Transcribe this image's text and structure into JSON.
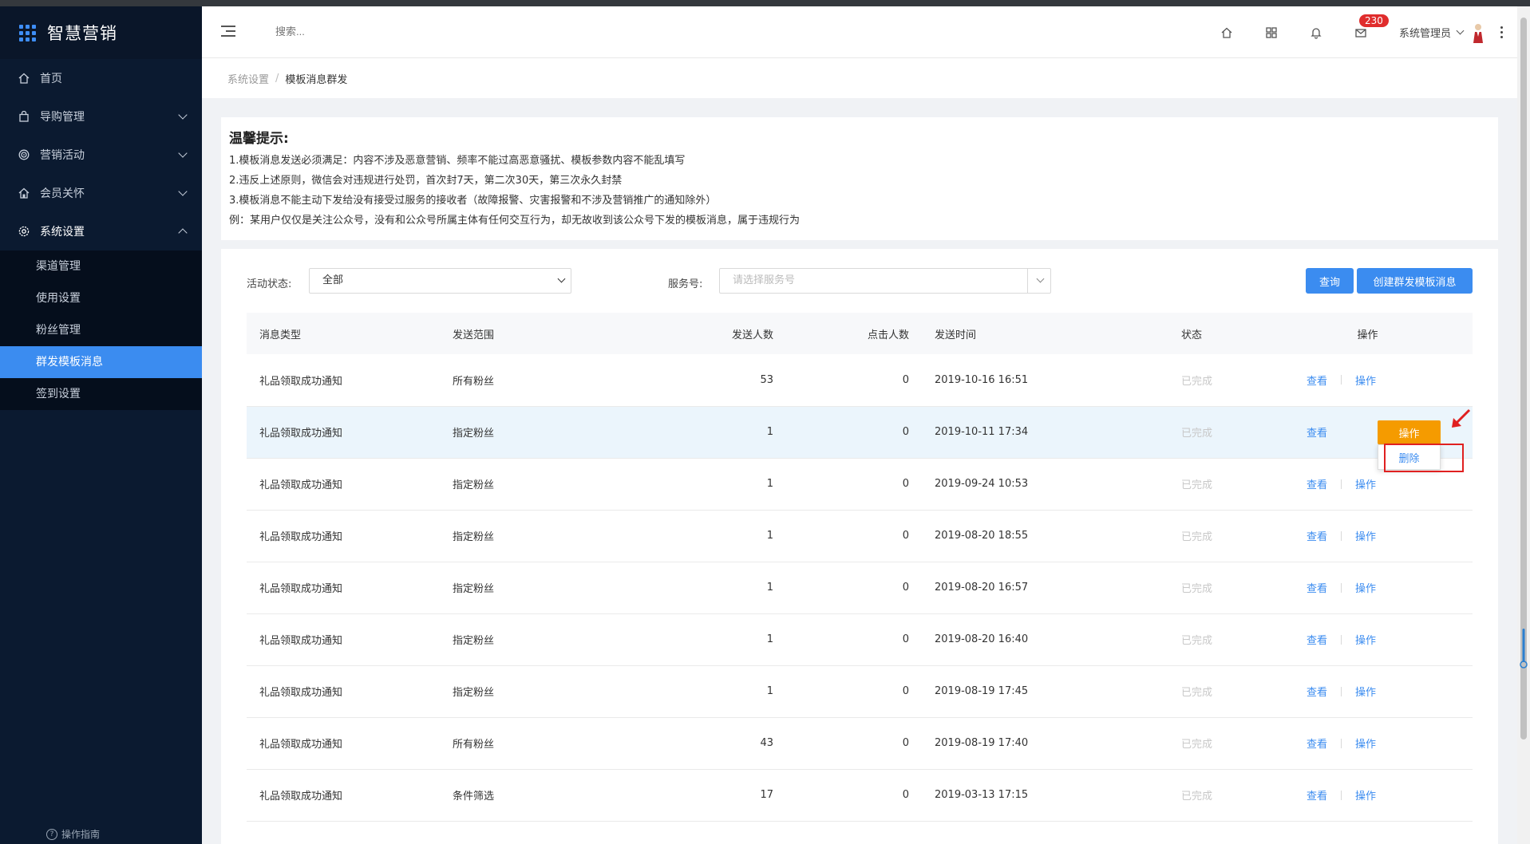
{
  "app": {
    "name": "智慧营销"
  },
  "sidebar": {
    "items": [
      {
        "label": "首页",
        "icon": "home-icon"
      },
      {
        "label": "导购管理",
        "icon": "bag-icon"
      },
      {
        "label": "营销活动",
        "icon": "target-icon"
      },
      {
        "label": "会员关怀",
        "icon": "house-heart-icon"
      },
      {
        "label": "系统设置",
        "icon": "gear-icon"
      }
    ],
    "submenu": [
      {
        "label": "渠道管理"
      },
      {
        "label": "使用设置"
      },
      {
        "label": "粉丝管理"
      },
      {
        "label": "群发模板消息",
        "active": true
      },
      {
        "label": "签到设置"
      }
    ],
    "guide": "操作指南"
  },
  "header": {
    "search_placeholder": "搜索...",
    "badge_count": "230",
    "user_name": "系统管理员"
  },
  "breadcrumb": {
    "parent": "系统设置",
    "current": "模板消息群发"
  },
  "tips": {
    "title": "温馨提示:",
    "lines": [
      "1.模板消息发送必须满足：内容不涉及恶意营销、频率不能过高恶意骚扰、模板参数内容不能乱填写",
      "2.违反上述原则，微信会对违规进行处罚，首次封7天，第二次30天，第三次永久封禁",
      "3.模板消息不能主动下发给没有接受过服务的接收者（故障报警、灾害报警和不涉及营销推广的通知除外）",
      "例：某用户仅仅是关注公众号，没有和公众号所属主体有任何交互行为，却无故收到该公众号下发的模板消息，属于违规行为"
    ]
  },
  "filters": {
    "status_label": "活动状态:",
    "status_value": "全部",
    "service_label": "服务号:",
    "service_placeholder": "请选择服务号",
    "query_button": "查询",
    "create_button": "创建群发模板消息"
  },
  "table": {
    "headers": [
      "消息类型",
      "发送范围",
      "发送人数",
      "点击人数",
      "发送时间",
      "状态",
      "操作"
    ],
    "rows": [
      {
        "type": "礼品领取成功通知",
        "scope": "所有粉丝",
        "sent": "53",
        "clicks": "0",
        "time": "2019-10-16 16:51",
        "status": "已完成",
        "view": "查看",
        "op": "操作"
      },
      {
        "type": "礼品领取成功通知",
        "scope": "指定粉丝",
        "sent": "1",
        "clicks": "0",
        "time": "2019-10-11 17:34",
        "status": "已完成",
        "view": "查看",
        "op": ""
      },
      {
        "type": "礼品领取成功通知",
        "scope": "指定粉丝",
        "sent": "1",
        "clicks": "0",
        "time": "2019-09-24 10:53",
        "status": "已完成",
        "view": "查看",
        "op": "操作"
      },
      {
        "type": "礼品领取成功通知",
        "scope": "指定粉丝",
        "sent": "1",
        "clicks": "0",
        "time": "2019-08-20 18:55",
        "status": "已完成",
        "view": "查看",
        "op": "操作"
      },
      {
        "type": "礼品领取成功通知",
        "scope": "指定粉丝",
        "sent": "1",
        "clicks": "0",
        "time": "2019-08-20 16:57",
        "status": "已完成",
        "view": "查看",
        "op": "操作"
      },
      {
        "type": "礼品领取成功通知",
        "scope": "指定粉丝",
        "sent": "1",
        "clicks": "0",
        "time": "2019-08-20 16:40",
        "status": "已完成",
        "view": "查看",
        "op": "操作"
      },
      {
        "type": "礼品领取成功通知",
        "scope": "指定粉丝",
        "sent": "1",
        "clicks": "0",
        "time": "2019-08-19 17:45",
        "status": "已完成",
        "view": "查看",
        "op": "操作"
      },
      {
        "type": "礼品领取成功通知",
        "scope": "所有粉丝",
        "sent": "43",
        "clicks": "0",
        "time": "2019-08-19 17:40",
        "status": "已完成",
        "view": "查看",
        "op": "操作"
      },
      {
        "type": "礼品领取成功通知",
        "scope": "条件筛选",
        "sent": "17",
        "clicks": "0",
        "time": "2019-03-13 17:15",
        "status": "已完成",
        "view": "查看",
        "op": "操作"
      }
    ]
  },
  "dropdown": {
    "button": "操作",
    "item": "删除"
  },
  "colors": {
    "accent": "#3b8cf0",
    "sidebar_bg": "#0b1a30",
    "warning": "#f59b00",
    "annotation": "#e02020"
  }
}
